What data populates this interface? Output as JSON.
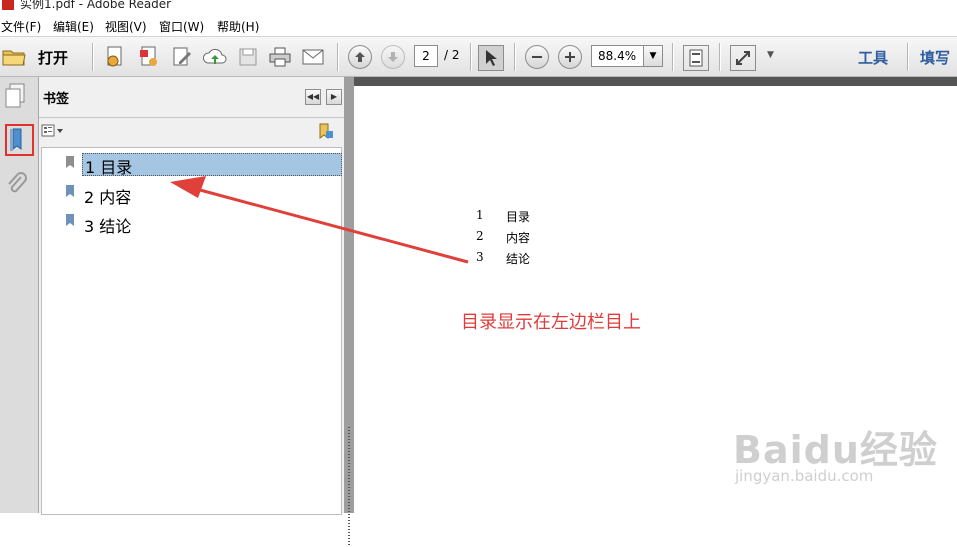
{
  "window": {
    "title": "实例1.pdf - Adobe Reader"
  },
  "menubar": {
    "items": [
      "文件(F)",
      "编辑(E)",
      "视图(V)",
      "窗口(W)",
      "帮助(H)"
    ]
  },
  "toolbar": {
    "open_label": "打开",
    "page_current": "2",
    "page_total": "/ 2",
    "zoom": "88.4%",
    "tools_label": "工具",
    "fill_sign_label": "填写"
  },
  "sidebar": {
    "panel_title": "书签",
    "bookmarks": [
      {
        "label": "1 目录",
        "selected": true
      },
      {
        "label": "2 内容",
        "selected": false
      },
      {
        "label": "3 结论",
        "selected": false
      }
    ]
  },
  "document": {
    "toc": [
      {
        "num": "1",
        "text": "目录"
      },
      {
        "num": "2",
        "text": "内容"
      },
      {
        "num": "3",
        "text": "结论"
      }
    ],
    "annotation": "目录显示在左边栏目上"
  },
  "watermark": {
    "line1": "Baidu经验",
    "line2": "jingyan.baidu.com"
  },
  "colors": {
    "selection": "#a5c6e2",
    "annotation_red": "#e03b3b",
    "toolbar_text_blue": "#2d5ea0"
  }
}
